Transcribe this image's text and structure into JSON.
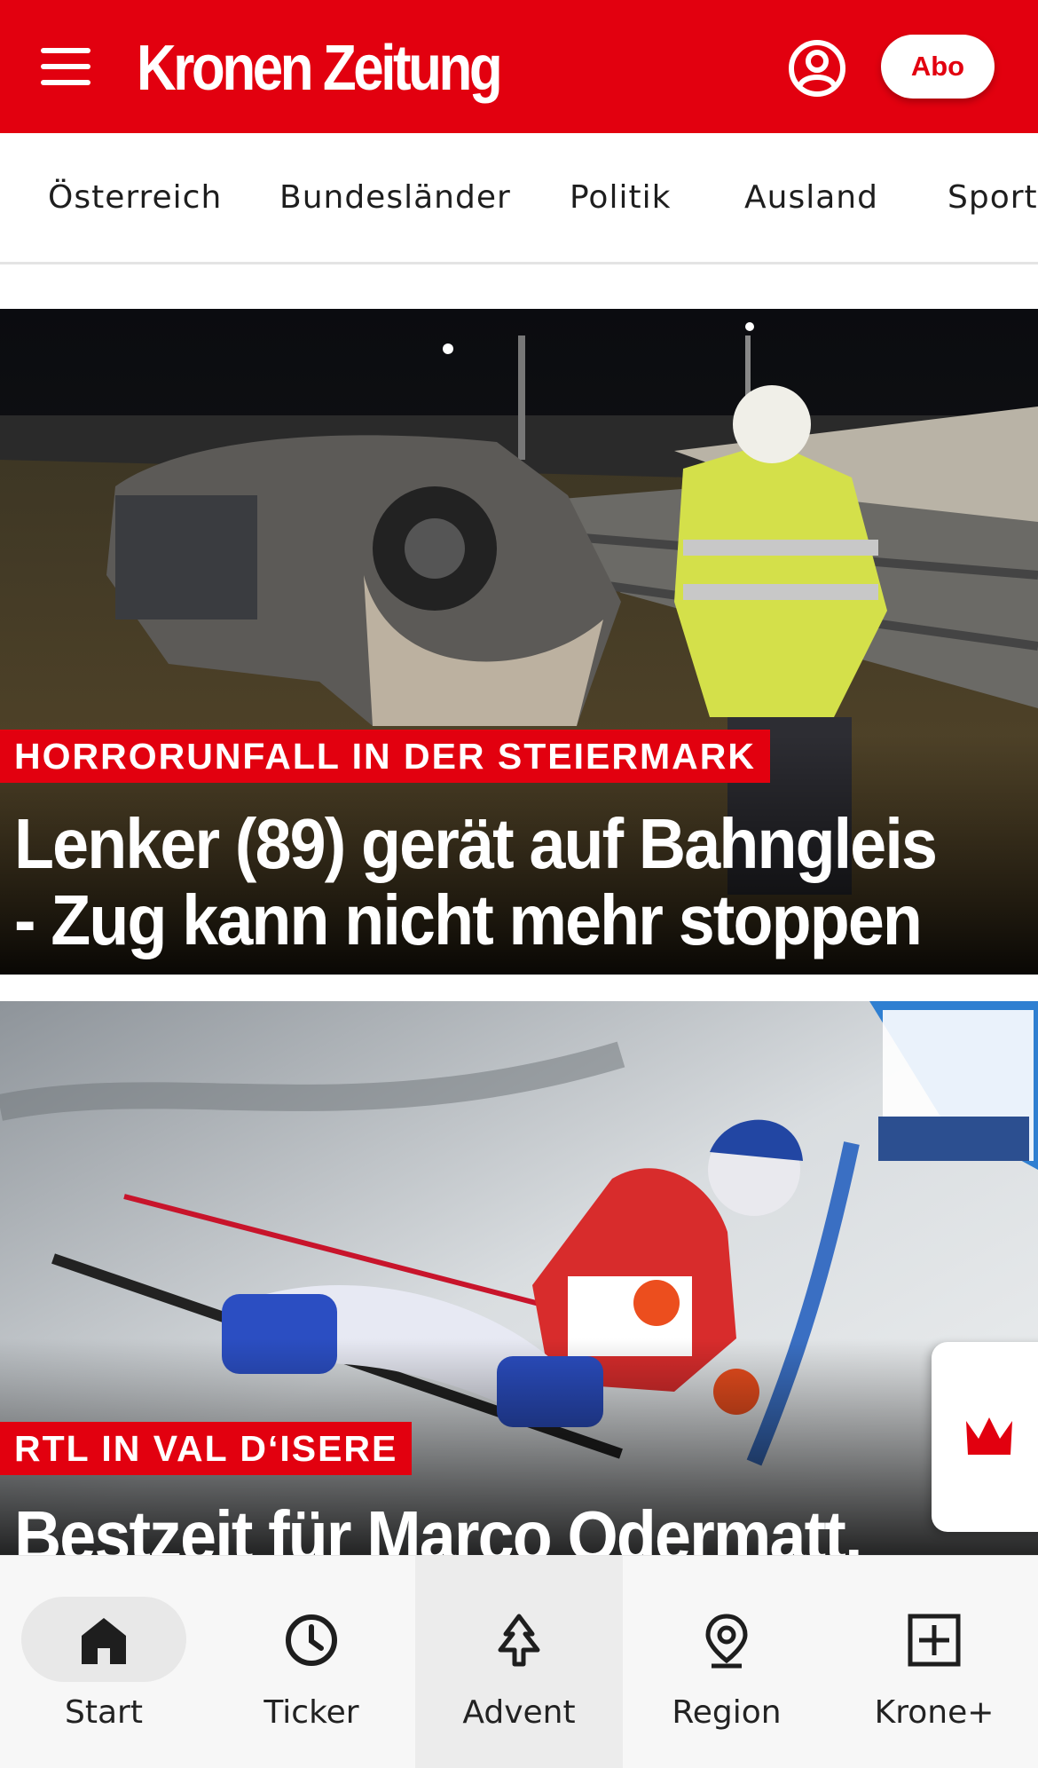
{
  "header": {
    "logo": "Kronen Zeitung",
    "abo_label": "Abo",
    "brand_color": "#e2000f"
  },
  "nav": {
    "categories": [
      {
        "label": "Österreich"
      },
      {
        "label": "Bundesländer"
      },
      {
        "label": "Politik"
      },
      {
        "label": "Ausland"
      },
      {
        "label": "Sport"
      }
    ]
  },
  "articles": [
    {
      "kicker": "HORRORUNFALL IN DER STEIERMARK",
      "headline_line1": "Lenker (89) gerät auf Bahngleis",
      "headline_line2": "- Zug kann nicht mehr stoppen",
      "image": "car-crash-photo"
    },
    {
      "kicker": "RTL IN VAL D‘ISERE",
      "headline_line1": "Bestzeit für Marco Odermatt,",
      "image": "ski-racer-photo"
    }
  ],
  "bottom_nav": {
    "items": [
      {
        "label": "Start",
        "icon": "home-icon",
        "active": true
      },
      {
        "label": "Ticker",
        "icon": "clock-icon"
      },
      {
        "label": "Advent",
        "icon": "tree-icon"
      },
      {
        "label": "Region",
        "icon": "location-pin-icon"
      },
      {
        "label": "Krone+",
        "icon": "plus-box-icon"
      }
    ]
  }
}
